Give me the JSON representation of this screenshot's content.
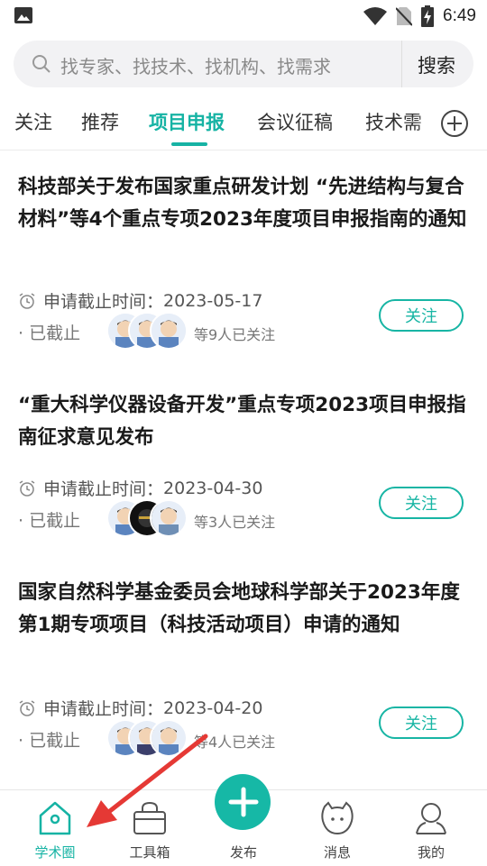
{
  "status_bar": {
    "time": "6:49"
  },
  "search": {
    "placeholder": "找专家、找技术、找机构、找需求",
    "button_label": "搜索"
  },
  "tabs": [
    {
      "label": "关注"
    },
    {
      "label": "推荐"
    },
    {
      "label": "项目申报",
      "active": true
    },
    {
      "label": "会议征稿"
    },
    {
      "label": "技术需"
    }
  ],
  "cards": [
    {
      "title": "科技部关于发布国家重点研发计划 “先进结构与复合材料”等4个重点专项2023年度项目申报指南的通知",
      "deadline_label": "申请截止时间：",
      "deadline": "2023-05-17",
      "status": "· 已截止",
      "followers": "等9人已关注",
      "follow_label": "关注"
    },
    {
      "title": "“重大科学仪器设备开发”重点专项2023项目申报指南征求意见发布",
      "deadline_label": "申请截止时间：",
      "deadline": "2023-04-30",
      "status": "· 已截止",
      "followers": "等3人已关注",
      "follow_label": "关注"
    },
    {
      "title": "国家自然科学基金委员会地球科学部关于2023年度第1期专项项目（科技活动项目）申请的通知",
      "deadline_label": "申请截止时间：",
      "deadline": "2023-04-20",
      "status": "· 已截止",
      "followers": "等4人已关注",
      "follow_label": "关注"
    }
  ],
  "bottom_nav": [
    {
      "label": "学术圈",
      "icon": "home-icon",
      "active": true
    },
    {
      "label": "工具箱",
      "icon": "toolbox-icon"
    },
    {
      "label": "发布",
      "icon": "plus-icon"
    },
    {
      "label": "消息",
      "icon": "message-icon"
    },
    {
      "label": "我的",
      "icon": "profile-icon"
    }
  ],
  "colors": {
    "accent": "#16b3a4",
    "arrow": "#e53935"
  }
}
